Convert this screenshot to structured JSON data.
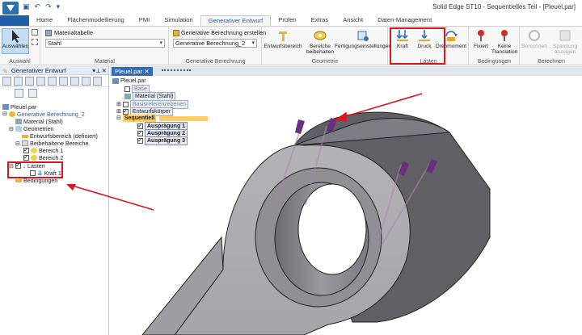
{
  "window": {
    "title": "Solid Edge ST10 - Sequentielles Teil - [Pleuel.par]"
  },
  "tabs": [
    "Home",
    "Flächenmodellierung",
    "PMI",
    "Simulation",
    "Generativer Entwurf",
    "Prüfen",
    "Extras",
    "Ansicht",
    "Daten-Management"
  ],
  "active_tab": "Generativer Entwurf",
  "ribbon": {
    "auswahl": {
      "button": "Auswählen",
      "group": "Auswahl"
    },
    "material": {
      "label": "Materialtabelle",
      "value": "Stahl",
      "group": "Material"
    },
    "berechnung": {
      "label": "Generative Berechnung erstellen",
      "value": "Generative Berechnung_2",
      "group": "Generative Berechnung"
    },
    "geometrie": {
      "buttons": [
        "Entwurfsbereich",
        "Bereiche beibehalten",
        "Fertigungseinstellungen"
      ],
      "group": "Geometrie"
    },
    "lasten": {
      "buttons": [
        "Kraft",
        "Druck",
        "Drehmoment"
      ],
      "group": "Lasten"
    },
    "bedingungen": {
      "buttons": [
        "Fixiert",
        "Keine Translation"
      ],
      "group": "Bedingungen"
    },
    "berechnen": {
      "buttons": [
        "Berechnen",
        "Spannung anzeigen"
      ],
      "group": "Berechnen"
    }
  },
  "panel": {
    "title": "Generativer Entwurf",
    "tree": {
      "root": "Pleuel.par",
      "study": "Generative Berechnung_2",
      "material": "Material (Stahl)",
      "geometry": "Geometrien",
      "design_area": "Entwurfsbereich (definiert)",
      "kept_areas": "Beibehaltene Bereiche",
      "area1": "Bereich 1",
      "area2": "Bereich 2",
      "loads": "Lasten",
      "force1": "Kraft 1",
      "constraints": "Bedingungen"
    }
  },
  "document": {
    "tab": "Pleuel.par",
    "tree": {
      "root": "Pleuel.par",
      "base": "Base",
      "material": "Material (Stahl)",
      "refplanes": "Basisreferenzebenen",
      "bodies": "Entwurfskörper",
      "sequential": "Sequentiell",
      "feature1": "Ausprägung 1",
      "feature2": "Ausprägung 2",
      "feature3": "Ausprägung 3"
    }
  },
  "colors": {
    "accent": "#1f5ea8",
    "annotation": "#d8161e",
    "part": "#a7a7ab",
    "force": "#6b2f7e"
  }
}
